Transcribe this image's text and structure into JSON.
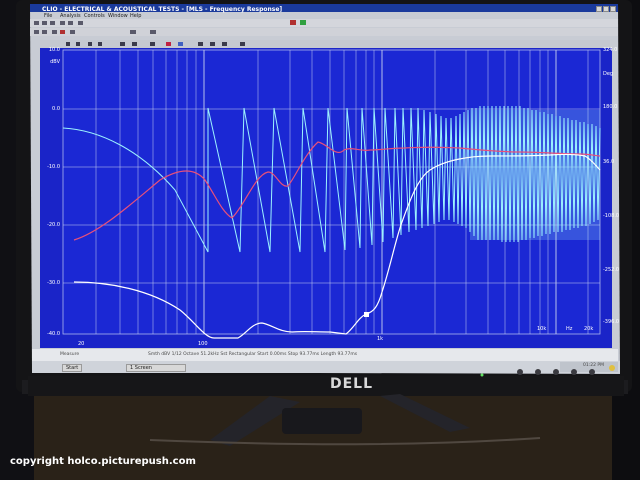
{
  "window": {
    "title": "CLIO - ELECTRICAL & ACOUSTICAL TESTS - [MLS - Frequency Response]",
    "menu": [
      "File",
      "Analysis",
      "Controls",
      "Window",
      "Help"
    ]
  },
  "graph": {
    "left_axis_unit": "dBV",
    "left_axis_ticks": [
      "10.0",
      "0.0",
      "-10.0",
      "-20.0",
      "-30.0",
      "-40.0"
    ],
    "right_axis_unit": "Deg",
    "right_axis_ticks": [
      "324.0",
      "180.0",
      "36.0",
      "-108.0",
      "-252.0",
      "-396.0"
    ],
    "x_axis_ticks": [
      "20",
      "100",
      "1k",
      "10k",
      "Hz",
      "20k"
    ],
    "colors": {
      "background": "#1a24c8",
      "grid": "#d0d8f0",
      "phase_wrapped": "#9cf2ff",
      "magnitude_red": "#e8507a",
      "magnitude_white": "#ffffff"
    }
  },
  "status_bar": {
    "left": "Measure",
    "mid_text": "Smth  dBV  1/12 Octave  51.2kHz  Sst  Rectangular  Start 0.00ms  Stop 93.77ms  Length 93.77ms",
    "right": "01:22 PM"
  },
  "taskbar": {
    "start_label": "Start",
    "task_label": "1 Screen"
  },
  "monitor": {
    "brand": "DELL"
  },
  "watermark": "copyright holco.picturepush.com"
}
